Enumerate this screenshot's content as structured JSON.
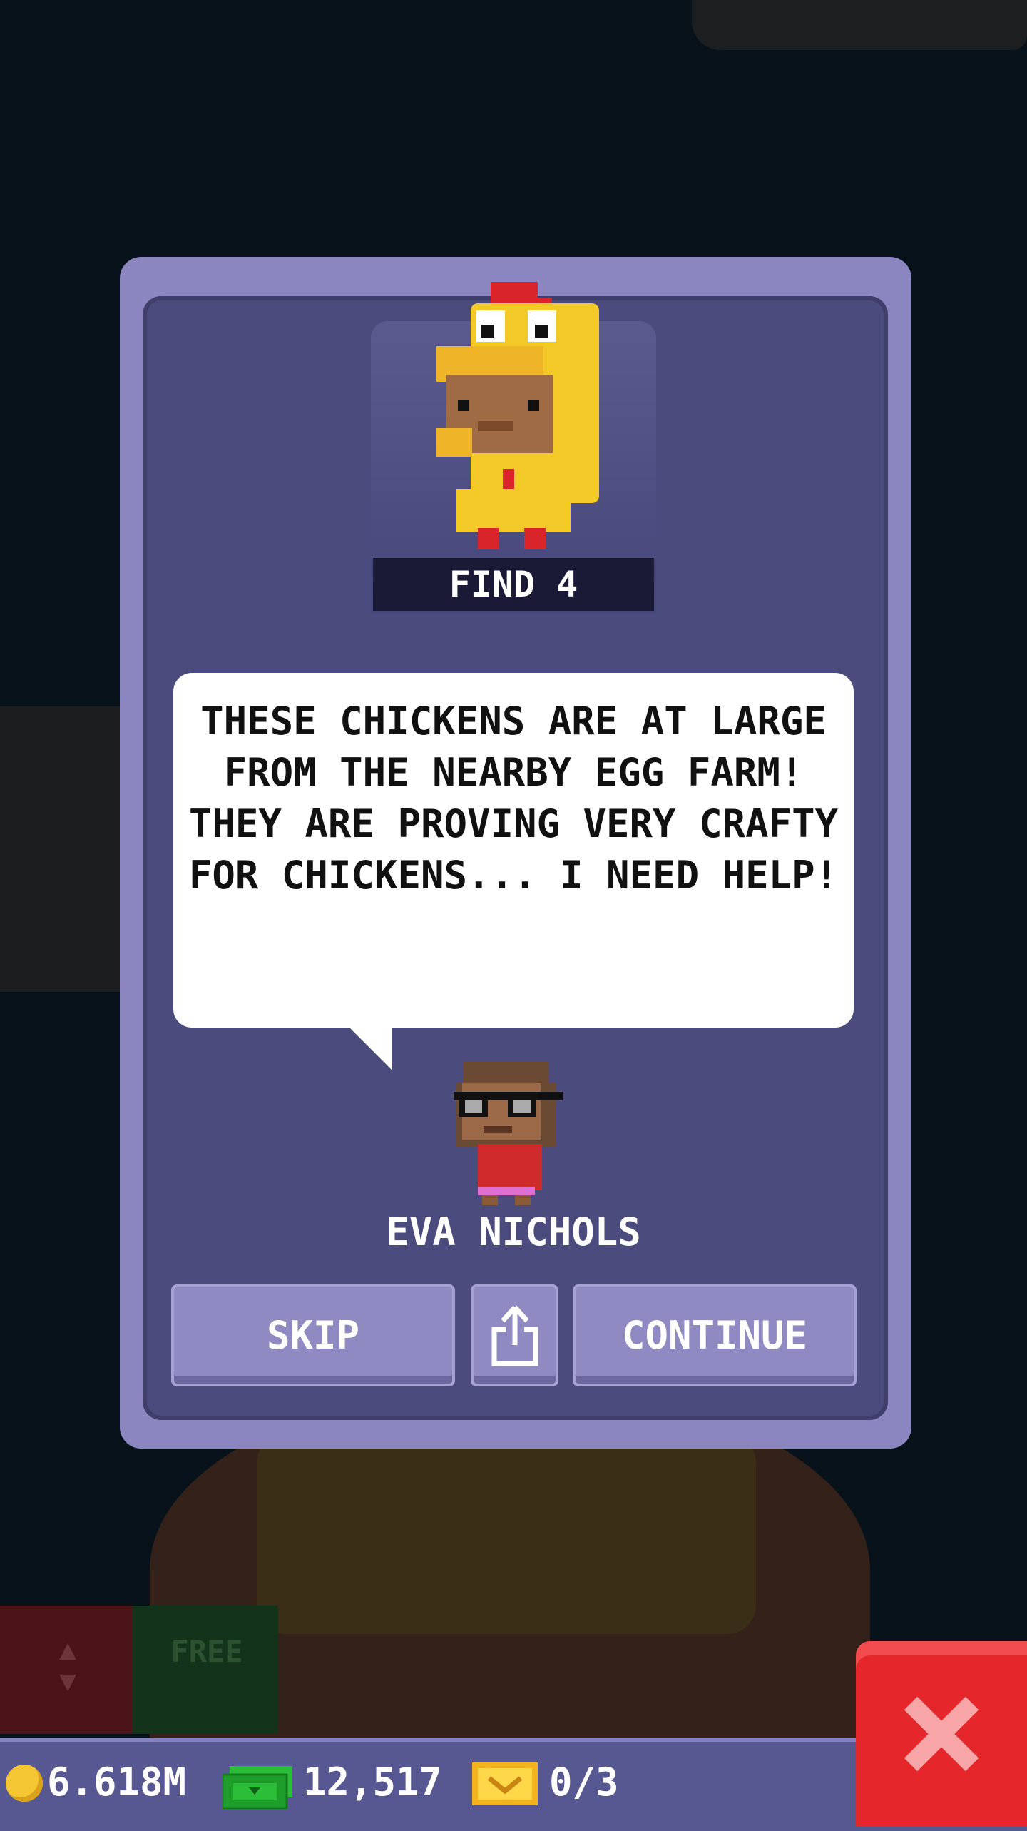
{
  "mission": {
    "find_label": "FIND 4"
  },
  "dialogue": {
    "text": "THESE CHICKENS ARE AT LARGE FROM THE NEARBY EGG FARM! THEY ARE PROVING VERY CRAFTY FOR CHICKENS... I NEED HELP!",
    "speaker": "EVA NICHOLS"
  },
  "buttons": {
    "skip_label": "SKIP",
    "continue_label": "CONTINUE",
    "share_icon": "share-icon",
    "close_icon": "close-x-icon"
  },
  "background": {
    "free_label": "FREE"
  },
  "status_bar": {
    "coins": "6.618M",
    "bux": "12,517",
    "tickets": "0/3"
  },
  "colors": {
    "dialog_border": "#8b86c0",
    "dialog_fill": "#4c4b7d",
    "button": "#8f8ac2",
    "close_red": "#e5272b",
    "coin_gold": "#f5c633",
    "bux_green": "#1f9d2b"
  }
}
